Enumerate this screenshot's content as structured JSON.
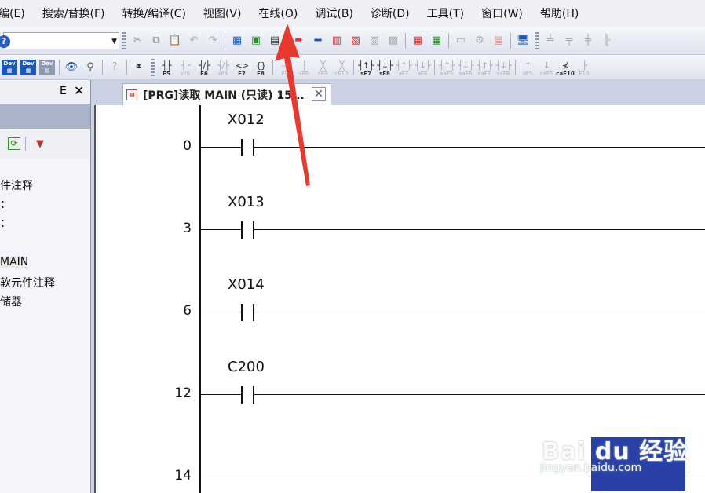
{
  "menu": [
    "编(E)",
    "搜索/替换(F)",
    "转换/编译(C)",
    "视图(V)",
    "在线(O)",
    "调试(B)",
    "诊断(D)",
    "工具(T)",
    "窗口(W)",
    "帮助(H)"
  ],
  "fkeys": [
    {
      "sym": "┤├",
      "lbl": "F5",
      "dim": false
    },
    {
      "sym": "┤├",
      "lbl": "sF5",
      "dim": true
    },
    {
      "sym": "┤/├",
      "lbl": "F6",
      "dim": false
    },
    {
      "sym": "┤/├",
      "lbl": "sF6",
      "dim": true
    },
    {
      "sym": "<>",
      "lbl": "F7",
      "dim": false
    },
    {
      "sym": "{}",
      "lbl": "F8",
      "dim": false
    },
    {
      "sym": "—",
      "lbl": "F9",
      "dim": true
    },
    {
      "sym": "┆",
      "lbl": "sF9",
      "dim": true
    },
    {
      "sym": "╳",
      "lbl": "cF9",
      "dim": true
    },
    {
      "sym": "╳",
      "lbl": "cF10",
      "dim": true
    },
    {
      "sym": "┤↑├",
      "lbl": "sF7",
      "dim": false
    },
    {
      "sym": "┤↓├",
      "lbl": "sF8",
      "dim": false
    },
    {
      "sym": "┤↑├",
      "lbl": "aF7",
      "dim": true
    },
    {
      "sym": "┤↓├",
      "lbl": "aF8",
      "dim": true
    },
    {
      "sym": "┤↑├",
      "lbl": "saF5",
      "dim": true
    },
    {
      "sym": "┤↓├",
      "lbl": "saF6",
      "dim": true
    },
    {
      "sym": "┤↑├",
      "lbl": "saF7",
      "dim": true
    },
    {
      "sym": "┤↓├",
      "lbl": "saF8",
      "dim": true
    },
    {
      "sym": "↑",
      "lbl": "aF5",
      "dim": true
    },
    {
      "sym": "↓",
      "lbl": "caF5",
      "dim": true
    },
    {
      "sym": "⊀",
      "lbl": "caF10",
      "dim": false
    },
    {
      "sym": "├",
      "lbl": "F10",
      "dim": true
    }
  ],
  "dev_buttons": [
    "Dev",
    "Dev",
    "Dev"
  ],
  "panel": {
    "pin": "ⴹ",
    "close": "✕",
    "tree": [
      "件注释",
      "：",
      "：",
      "MAIN",
      "软元件注释",
      "储器"
    ]
  },
  "tab": {
    "title": "[PRG]读取 MAIN (只读) 15...",
    "close": "✕"
  },
  "rungs": [
    {
      "step": "0",
      "device": "X012"
    },
    {
      "step": "3",
      "device": "X013"
    },
    {
      "step": "6",
      "device": "X014"
    },
    {
      "step": "12",
      "device": "C200"
    },
    {
      "step": "14",
      "device": ""
    }
  ],
  "watermark": {
    "main": "Bai du 经验",
    "sub": "jingyan.baidu.com"
  },
  "colors": {
    "accent": "#1b58b8",
    "arrow": "#e8392e"
  }
}
